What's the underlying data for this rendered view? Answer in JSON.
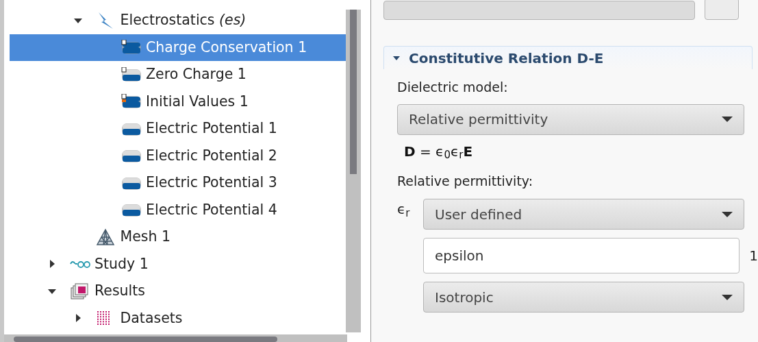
{
  "tree": [
    {
      "kind": "hidden-parent",
      "children": [
        {
          "kind": "physics",
          "label": "Electrostatics *(es)*",
          "expanded": true,
          "selected": false,
          "children": [
            {
              "kind": "conservation",
              "label": "Charge Conservation 1",
              "selected": true
            },
            {
              "kind": "zero-charge",
              "label": "Zero Charge 1",
              "selected": false
            },
            {
              "kind": "initial",
              "label": "Initial Values 1",
              "selected": false
            },
            {
              "kind": "boundary",
              "label": "Electric Potential 1",
              "selected": false
            },
            {
              "kind": "boundary",
              "label": "Electric Potential 2",
              "selected": false
            },
            {
              "kind": "boundary",
              "label": "Electric Potential 3",
              "selected": false
            },
            {
              "kind": "boundary",
              "label": "Electric Potential 4",
              "selected": false
            }
          ]
        },
        {
          "kind": "mesh",
          "label": "Mesh 1",
          "selected": false
        }
      ]
    },
    {
      "kind": "study",
      "label": "Study 1",
      "expanded": false,
      "selected": false
    },
    {
      "kind": "results",
      "label": "Results",
      "expanded": true,
      "selected": false,
      "children": [
        {
          "kind": "datasets",
          "label": "Datasets",
          "expanded": false,
          "selected": false
        }
      ]
    }
  ],
  "settings": {
    "section": {
      "title": "Constitutive Relation D-E",
      "expanded": true
    },
    "dielectric_model_label": "Dielectric model:",
    "dielectric_model": "Relative permittivity",
    "formula": "**D** = ϵ$_{0}$ϵ$_{r}$**E**",
    "relative_permittivity_label": "Relative permittivity:",
    "symbol": "ϵ$_{r}$",
    "source": "User defined",
    "value": "epsilon",
    "unit": "1",
    "anisotropy": "Isotropic"
  }
}
